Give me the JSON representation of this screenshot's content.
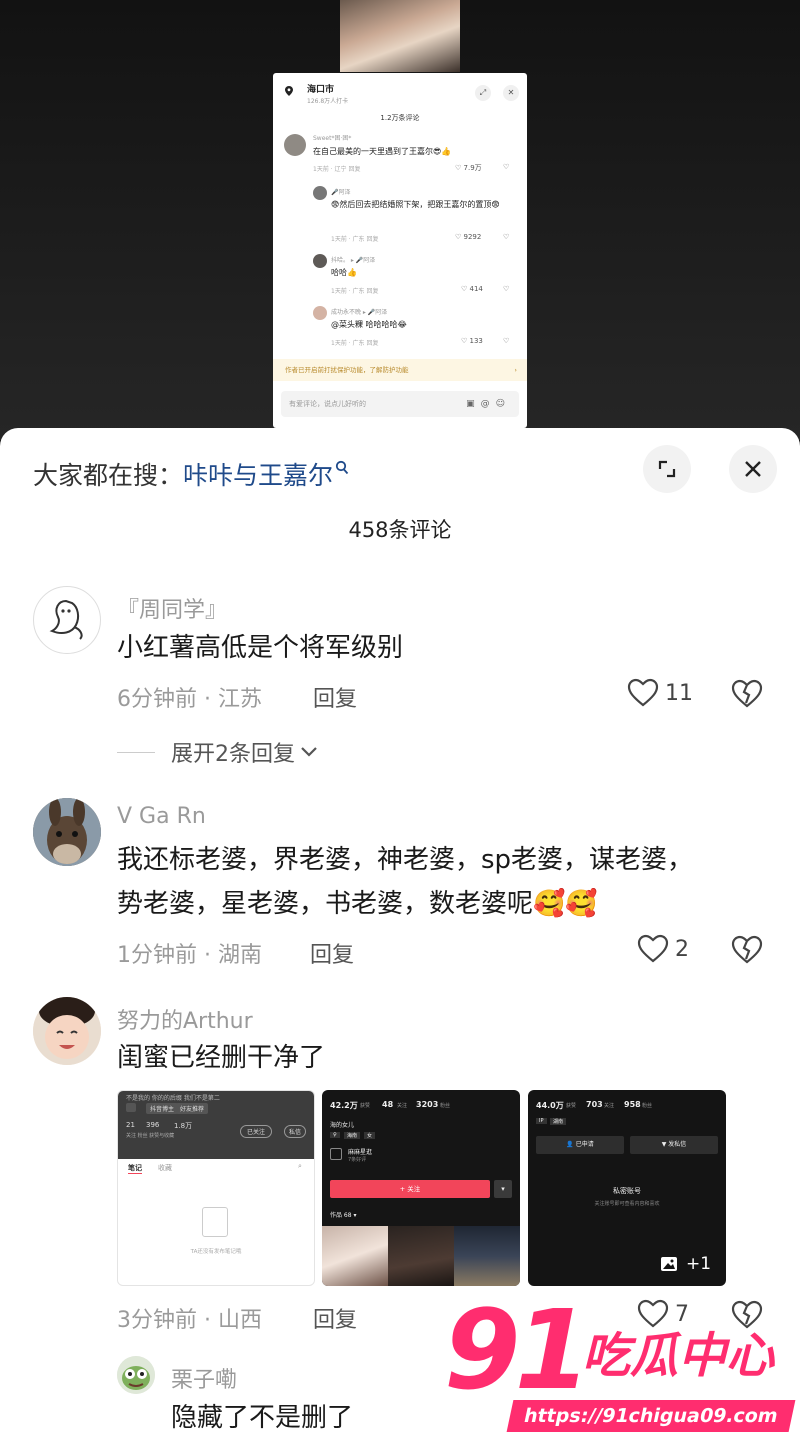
{
  "inner_screenshot": {
    "location": "海口市",
    "views": "126.8万人打卡",
    "comment_count": "1.2万条评论",
    "comments": [
      {
        "name": "Sweet*困·困*",
        "text": "在自己最美的一天里遇到了王嘉尔😎👍",
        "meta": "1天前 · 辽宁    回复",
        "likes": "7.9万"
      },
      {
        "name": "🎤阿泽",
        "text": "😨然后回去把结婚照下架，把跟王嘉尔的置顶😨",
        "meta": "1天前 · 广东    回复",
        "likes": "9292"
      },
      {
        "name": "抖哈。 ▸ 🎤阿泽",
        "text": "哈哈👍",
        "meta": "1天前 · 广东    回复",
        "likes": "414"
      },
      {
        "name": "成功永不晚 ▸ 🎤阿泽",
        "text": "@菜头粿 哈哈哈哈😂",
        "meta": "1天前 · 广东    回复",
        "likes": "133"
      }
    ],
    "notice": "作者已开启前打扰保护功能，了解防护功能",
    "input_placeholder": "有爱评论，说点儿好听的"
  },
  "header": {
    "hot_search_label": "大家都在搜：",
    "hot_search_keyword": "咔咔与王嘉尔",
    "comment_count": "458条评论"
  },
  "comments": [
    {
      "name": "『周同学』",
      "text": "小红薯高低是个将军级别",
      "time_location": "6分钟前 · 江苏",
      "reply_label": "回复",
      "likes": "11",
      "expand_label": "展开2条回复"
    },
    {
      "name": "V  Ga  Rn",
      "text_line1": "我还标老婆，界老婆，神老婆，sp老婆，谋老婆，",
      "text_line2": "势老婆，星老婆，书老婆，数老婆呢🥰🥰",
      "time_location": "1分钟前 · 湖南",
      "reply_label": "回复",
      "likes": "2"
    },
    {
      "name": "努力的Arthur",
      "text": "闺蜜已经删干净了",
      "time_location": "3分钟前 · 山西",
      "reply_label": "回复",
      "likes": "7"
    },
    {
      "name": "栗子嘞",
      "text": "隐藏了不是删了"
    }
  ],
  "attachments": {
    "shot1": {
      "top_text": "不是我的  你的的后缀  我们不是第二",
      "tag1": "抖音博主",
      "tag2": "好友推荐",
      "stat1": "21",
      "stat2": "396",
      "stat3": "1.8万",
      "stat_labels": "关注  粉丝  获赞与收藏",
      "followed": "已关注",
      "msg": "私信",
      "tab1": "笔记",
      "tab2": "收藏",
      "empty_text": "TA还没有发布笔记哦"
    },
    "shot2": {
      "likes": "42.2万",
      "likes_label": "获赞",
      "following": "48",
      "following_label": "关注",
      "fans": "3203",
      "fans_label": "粉丝",
      "bio": "海的女儿",
      "tag1": "♀",
      "tag2": "海南",
      "tag3": "女",
      "shop": "麻麻星逛",
      "shop_sub": "7条好评",
      "follow_btn": "+ 关注",
      "works_label": "作品 68 ▾"
    },
    "shot3": {
      "likes": "44.0万",
      "likes_label": "获赞",
      "following": "703",
      "following_label": "关注",
      "fans": "958",
      "fans_label": "粉丝",
      "tag": "IP",
      "tag2": "湖南",
      "btn1": "已申请",
      "btn2": "发私信",
      "private_title": "私密账号",
      "private_sub": "关注账号即可查看内容和喜欢",
      "more": "+1"
    }
  },
  "watermark": {
    "number": "91",
    "brand": "吃瓜中心",
    "url": "https://91chigua09.com"
  },
  "colors": {
    "keyword": "#1f4a8a",
    "watermark": "#ff2d6f",
    "follow_red": "#f2455a"
  }
}
